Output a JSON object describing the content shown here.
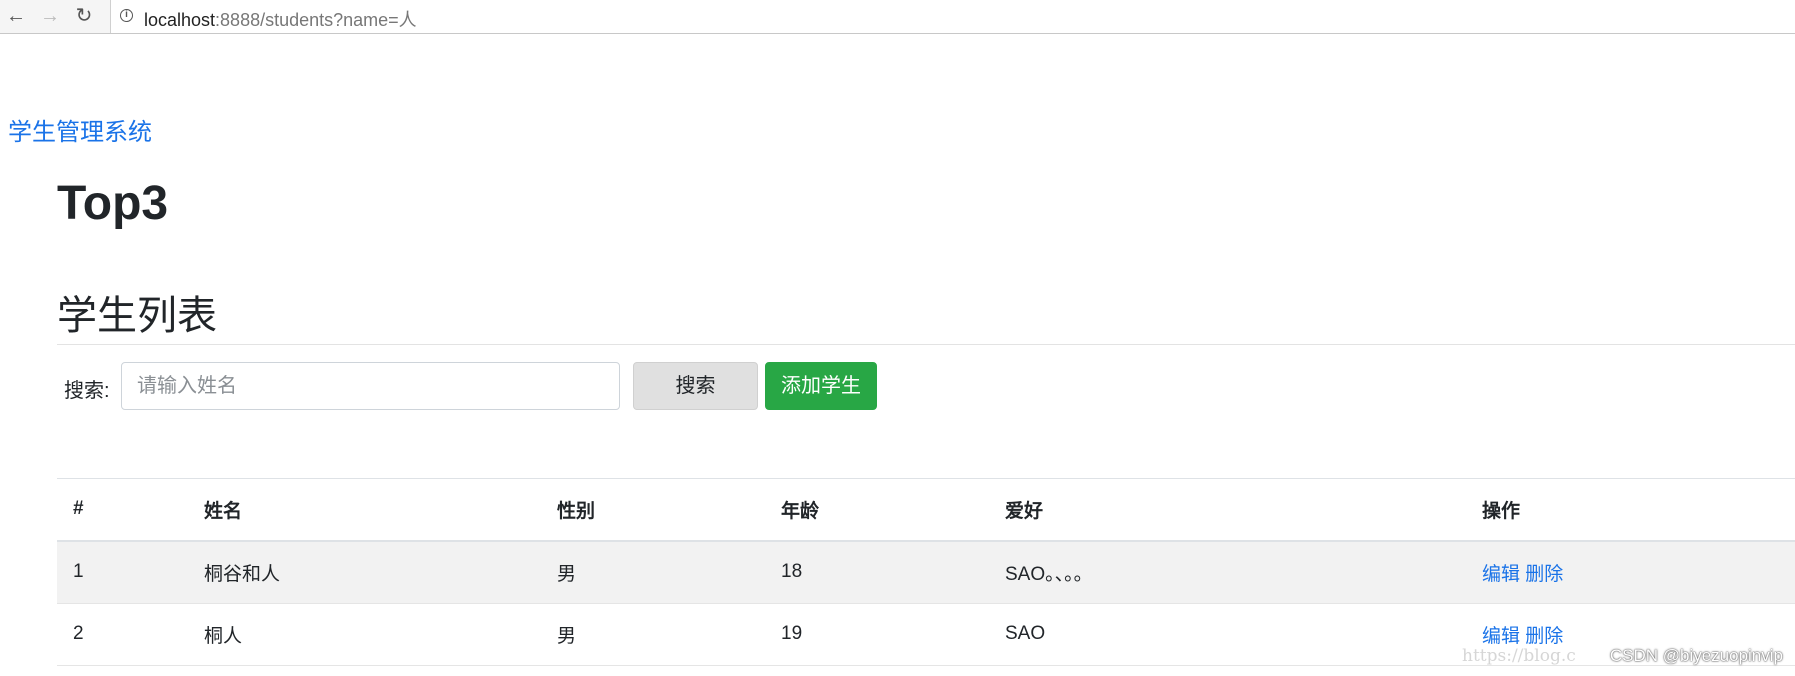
{
  "browser": {
    "url_host": "localhost",
    "url_rest": ":8888/students?name=人"
  },
  "brand": "学生管理系统",
  "page_title": "Top3",
  "section_title": "学生列表",
  "search": {
    "label": "搜索:",
    "placeholder": "请输入姓名",
    "search_button": "搜索",
    "add_button": "添加学生"
  },
  "table": {
    "headers": [
      "#",
      "姓名",
      "性别",
      "年龄",
      "爱好",
      "操作"
    ],
    "rows": [
      {
        "num": "1",
        "name": "桐谷和人",
        "gender": "男",
        "age": "18",
        "hobby": "SAO。、。。",
        "edit": "编辑",
        "delete": "删除"
      },
      {
        "num": "2",
        "name": "桐人",
        "gender": "男",
        "age": "19",
        "hobby": "SAO",
        "edit": "编辑",
        "delete": "删除"
      }
    ]
  },
  "watermark": "CSDN @biyezuopinvip",
  "watermark_faint": "https://blog.c"
}
